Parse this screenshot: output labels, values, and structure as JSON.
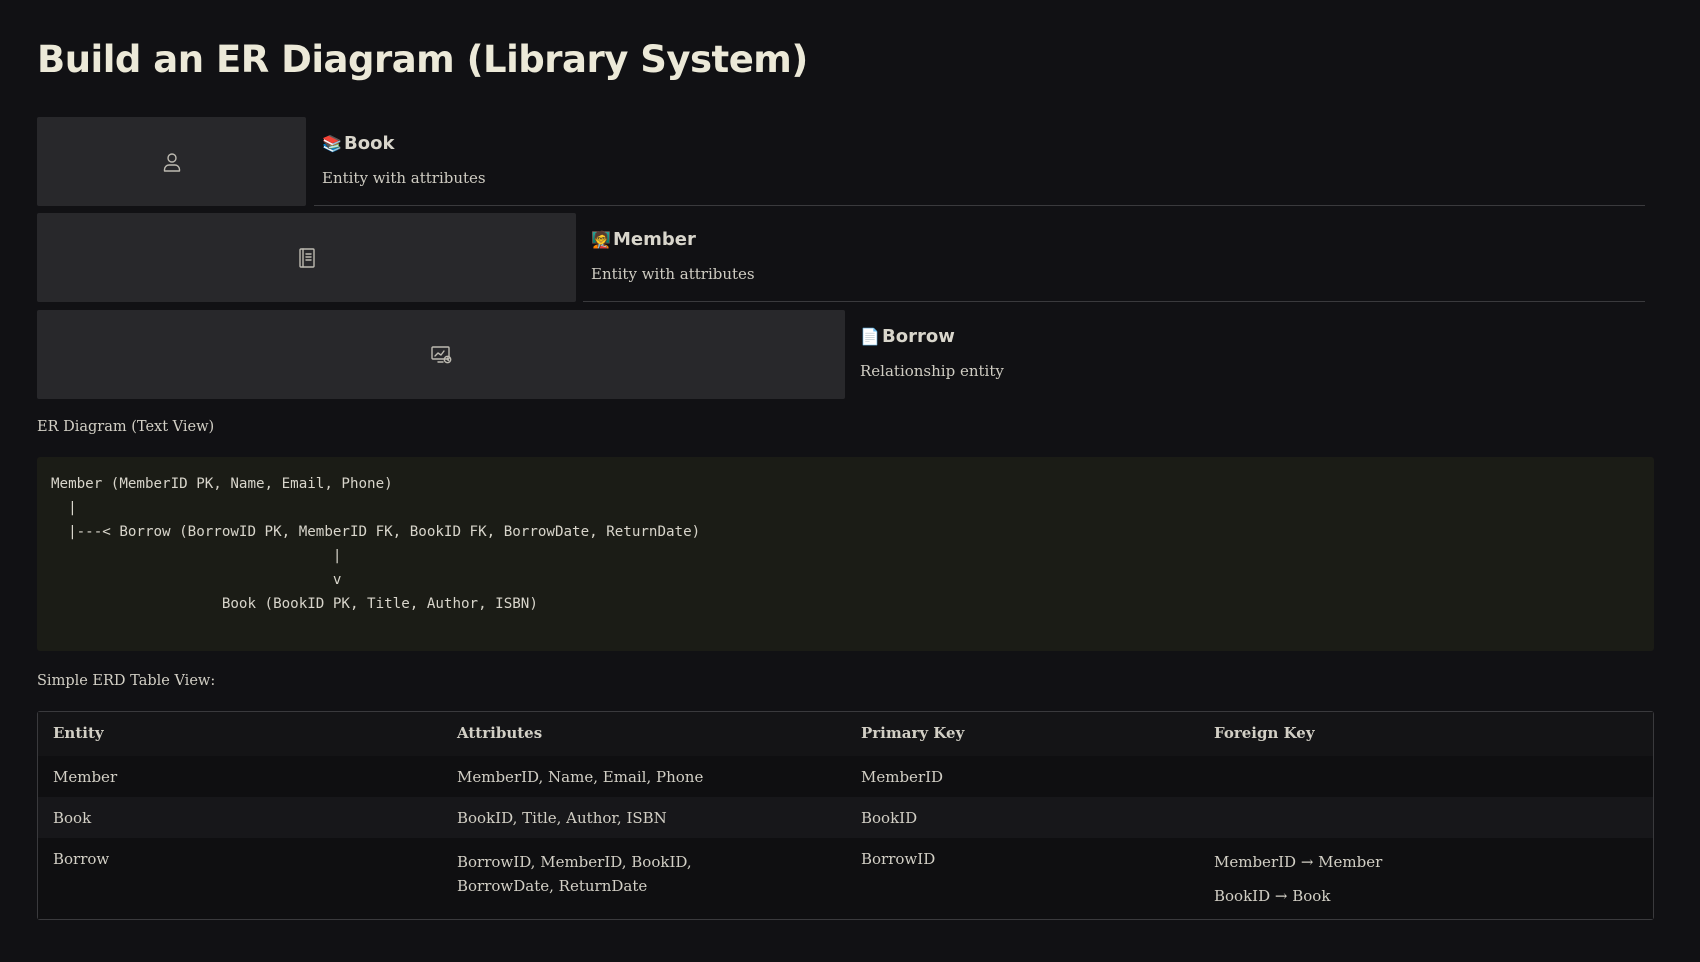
{
  "page": {
    "title": "Build an ER Diagram (Library System)"
  },
  "cards": [
    {
      "title": "Book",
      "emoji": "📚",
      "description": "Entity with attributes",
      "thumb_icon": "user-icon"
    },
    {
      "title": "Member",
      "emoji": "🧑‍🏫",
      "description": "Entity with attributes",
      "thumb_icon": "book-icon"
    },
    {
      "title": "Borrow",
      "emoji": "📄",
      "description": "Relationship entity",
      "thumb_icon": "monitor-chart-icon"
    }
  ],
  "diagram": {
    "label": "ER Diagram (Text View)",
    "code": "Member (MemberID PK, Name, Email, Phone)\n  |\n  |---< Borrow (BorrowID PK, MemberID FK, BookID FK, BorrowDate, ReturnDate)\n                                 |\n                                 v\n                    Book (BookID PK, Title, Author, ISBN)"
  },
  "table": {
    "label": "Simple ERD Table View:",
    "headers": [
      "Entity",
      "Attributes",
      "Primary Key",
      "Foreign Key"
    ],
    "rows": [
      {
        "entity": "Member",
        "attributes": "MemberID, Name, Email, Phone",
        "primary_key": "MemberID",
        "foreign_keys": []
      },
      {
        "entity": "Book",
        "attributes": "BookID, Title, Author, ISBN",
        "primary_key": "BookID",
        "foreign_keys": []
      },
      {
        "entity": "Borrow",
        "attributes": "BorrowID, MemberID, BookID, BorrowDate, ReturnDate",
        "primary_key": "BorrowID",
        "foreign_keys": [
          "MemberID → Member",
          "BookID → Book"
        ]
      }
    ]
  },
  "colors": {
    "background": "#111114",
    "card_thumb": "#28282b",
    "code_background": "#1b1c16",
    "text": "#e6e3da"
  }
}
